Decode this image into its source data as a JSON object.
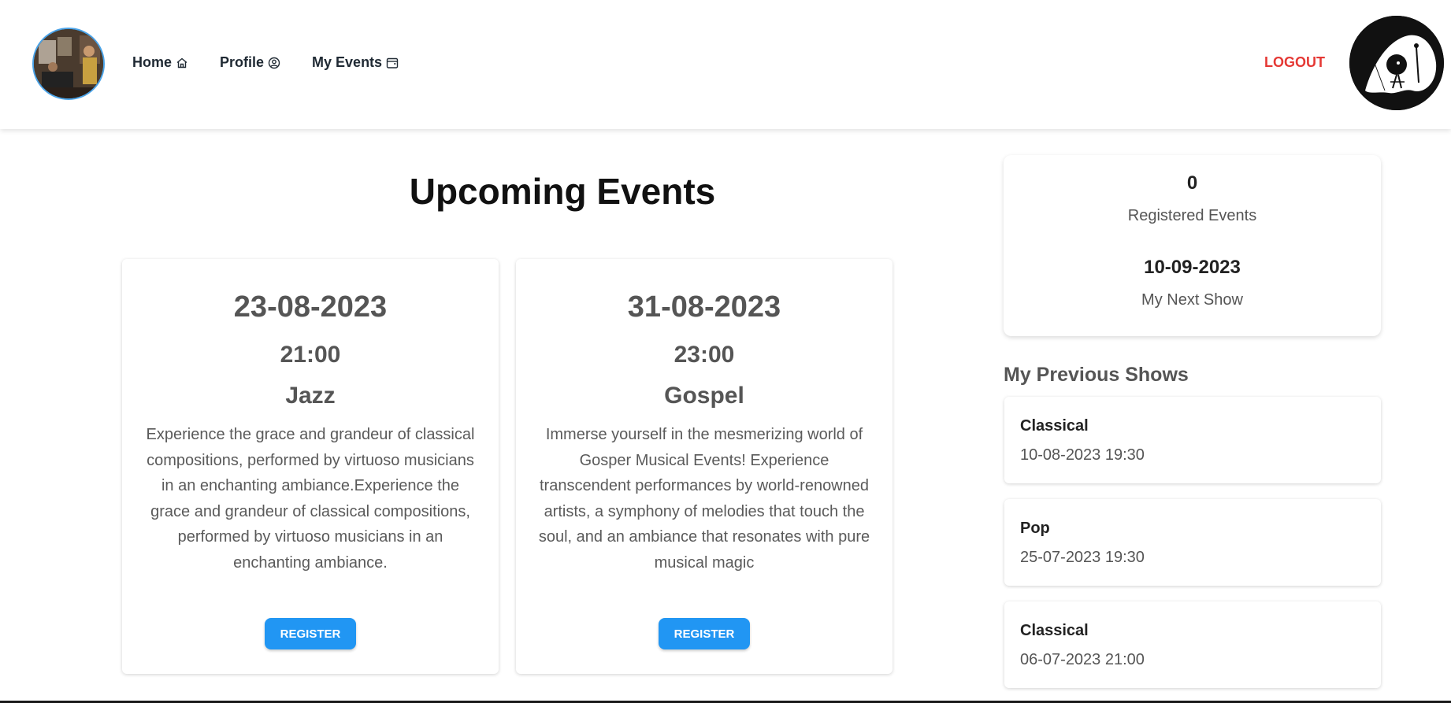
{
  "nav": {
    "home": "Home",
    "profile": "Profile",
    "my_events": "My Events",
    "logout": "LOGOUT"
  },
  "page": {
    "title": "Upcoming Events"
  },
  "events": [
    {
      "date": "23-08-2023",
      "time": "21:00",
      "genre": "Jazz",
      "description": "Experience the grace and grandeur of classical compositions, performed by virtuoso musicians in an enchanting ambiance.Experience the grace and grandeur of classical compositions, performed by virtuoso musicians in an enchanting ambiance.",
      "button": "REGISTER"
    },
    {
      "date": "31-08-2023",
      "time": "23:00",
      "genre": "Gospel",
      "description": "Immerse yourself in the mesmerizing world of Gosper Musical Events! Experience transcendent performances by world-renowned artists, a symphony of melodies that touch the soul, and an ambiance that resonates with pure musical magic",
      "button": "REGISTER"
    }
  ],
  "stats": {
    "registered_count": "0",
    "registered_label": "Registered Events",
    "next_show_date": "10-09-2023",
    "next_show_label": "My Next Show"
  },
  "previous_shows": {
    "title": "My Previous Shows",
    "items": [
      {
        "genre": "Classical",
        "datetime": "10-08-2023 19:30"
      },
      {
        "genre": "Pop",
        "datetime": "25-07-2023 19:30"
      },
      {
        "genre": "Classical",
        "datetime": "06-07-2023 21:00"
      }
    ]
  },
  "colors": {
    "accent": "#2196f3",
    "logout": "#e53935"
  }
}
